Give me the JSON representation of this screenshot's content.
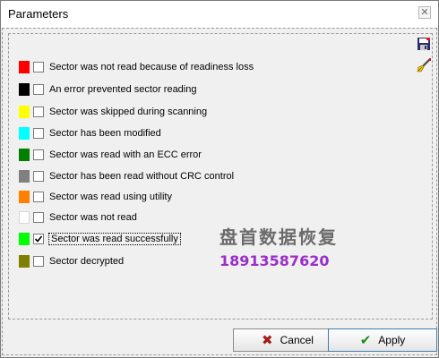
{
  "window": {
    "title": "Parameters",
    "close_glyph": "✕"
  },
  "toolbar": {
    "save_icon": "save-icon",
    "clear_icon": "brush-icon"
  },
  "legend_items": [
    {
      "color": "#ff0000",
      "label": "Sector was not read because of readiness loss",
      "checked": false
    },
    {
      "color": "#000000",
      "label": "An error prevented sector reading",
      "checked": false
    },
    {
      "color": "#ffff00",
      "label": "Sector was skipped during scanning",
      "checked": false
    },
    {
      "color": "#00ffff",
      "label": "Sector has been modified",
      "checked": false
    },
    {
      "color": "#007f00",
      "label": "Sector was read with an ECC error",
      "checked": false
    },
    {
      "color": "#808080",
      "label": "Sector has been read without CRC control",
      "checked": false
    },
    {
      "color": "#ff7f00",
      "label": "Sector was read using utility",
      "checked": false
    },
    {
      "color": "#ffffff",
      "label": "Sector was not read",
      "checked": false
    },
    {
      "color": "#00ff00",
      "label": "Sector was read successfully",
      "checked": true
    },
    {
      "color": "#7f7f00",
      "label": "Sector decrypted",
      "checked": false
    }
  ],
  "watermark": {
    "line1": "盘首数据恢复",
    "line2": "18913587620"
  },
  "buttons": {
    "cancel_label": "Cancel",
    "apply_label": "Apply"
  }
}
